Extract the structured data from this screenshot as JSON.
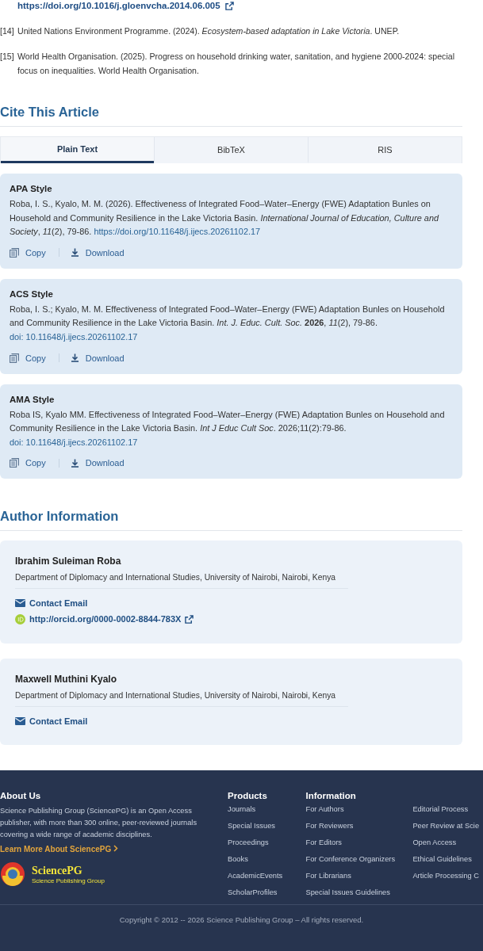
{
  "references": {
    "top_link": "https://doi.org/10.1016/j.gloenvcha.2014.06.005",
    "items": [
      {
        "number": "[14]",
        "text": "United Nations Environment Programme. (2024). *Ecosystem-based adaptation in Lake Victoria*. UNEP."
      },
      {
        "number": "[15]",
        "text": "World Health Organisation. (2025). Progress on household drinking water, sanitation, and hygiene 2000-2024: special focus on inequalities. World Health Organisation."
      }
    ]
  },
  "cite": {
    "title": "Cite This Article",
    "tabs": [
      {
        "label": "Plain Text",
        "selected": true
      },
      {
        "label": "BibTeX",
        "selected": false
      },
      {
        "label": "RIS",
        "selected": false
      }
    ],
    "styles": [
      {
        "title": "APA Style",
        "text": "Roba, I. S., Kyalo, M. M. (2026). Effectiveness of Integrated Food–Water–Energy (FWE) Adaptation Bunles on Household and Community Resilience in the Lake Victoria Basin. *International Journal of Education, Culture and Society*, *11*(2), 79-86.",
        "link": "https://doi.org/10.11648/j.ijecs.20261102.17",
        "actions": [
          "Copy",
          "Download"
        ]
      },
      {
        "title": "ACS Style",
        "text": "Roba, I. S.; Kyalo, M. M. Effectiveness of Integrated Food–Water–Energy (FWE) Adaptation Bunles on Household and Community Resilience in the Lake Victoria Basin. *Int. J. Educ. Cult. Soc.* **2026**, *11*(2), 79-86.",
        "link": "doi: 10.11648/j.ijecs.20261102.17",
        "actions": [
          "Copy",
          "Download"
        ]
      },
      {
        "title": "AMA Style",
        "text": "Roba IS, Kyalo MM. Effectiveness of Integrated Food–Water–Energy (FWE) Adaptation Bunles on Household and Community Resilience in the Lake Victoria Basin. *Int J Educ Cult Soc*. 2026;11(2):79-86.",
        "link": "doi: 10.11648/j.ijecs.20261102.17",
        "actions": [
          "Copy",
          "Download"
        ]
      }
    ]
  },
  "authors": {
    "title": "Author Information",
    "items": [
      {
        "name": "Ibrahim Suleiman Roba",
        "affiliation": "Department of Diplomacy and International Studies, University of Nairobi, Nairobi, Kenya",
        "links": [
          {
            "kind": "email",
            "label": "Contact Email"
          },
          {
            "kind": "orcid",
            "label": "http://orcid.org/0000-0002-8844-783X"
          }
        ]
      },
      {
        "name": "Maxwell Muthini Kyalo",
        "affiliation": "Department of Diplomacy and International Studies, University of Nairobi, Nairobi, Kenya",
        "links": [
          {
            "kind": "email",
            "label": "Contact Email"
          }
        ]
      }
    ]
  },
  "footer": {
    "about": {
      "title": "About Us",
      "text": "Science Publishing Group (SciencePG) is an Open Access publisher, with more than 300 online, peer-reviewed journals covering a wide range of academic disciplines.",
      "link": "Learn More About SciencePG",
      "logo_name": "SciencePG",
      "logo_tagline": "Science Publishing Group"
    },
    "columns": [
      {
        "title": "Products",
        "links": [
          "Journals",
          "Special Issues",
          "Proceedings",
          "Books",
          "AcademicEvents",
          "ScholarProfiles"
        ]
      },
      {
        "title": "Information",
        "links": [
          "For Authors",
          "For Reviewers",
          "For Editors",
          "For Conference Organizers",
          "For Librarians",
          "Special Issues Guidelines"
        ]
      },
      {
        "links": [
          "Editorial Process",
          "Peer Review at Scie",
          "Open Access",
          "Ethical Guidelines",
          "Article Processing C"
        ]
      }
    ],
    "copyright": "Copyright © 2012 -- 2026 Science Publishing Group – All rights reserved."
  }
}
